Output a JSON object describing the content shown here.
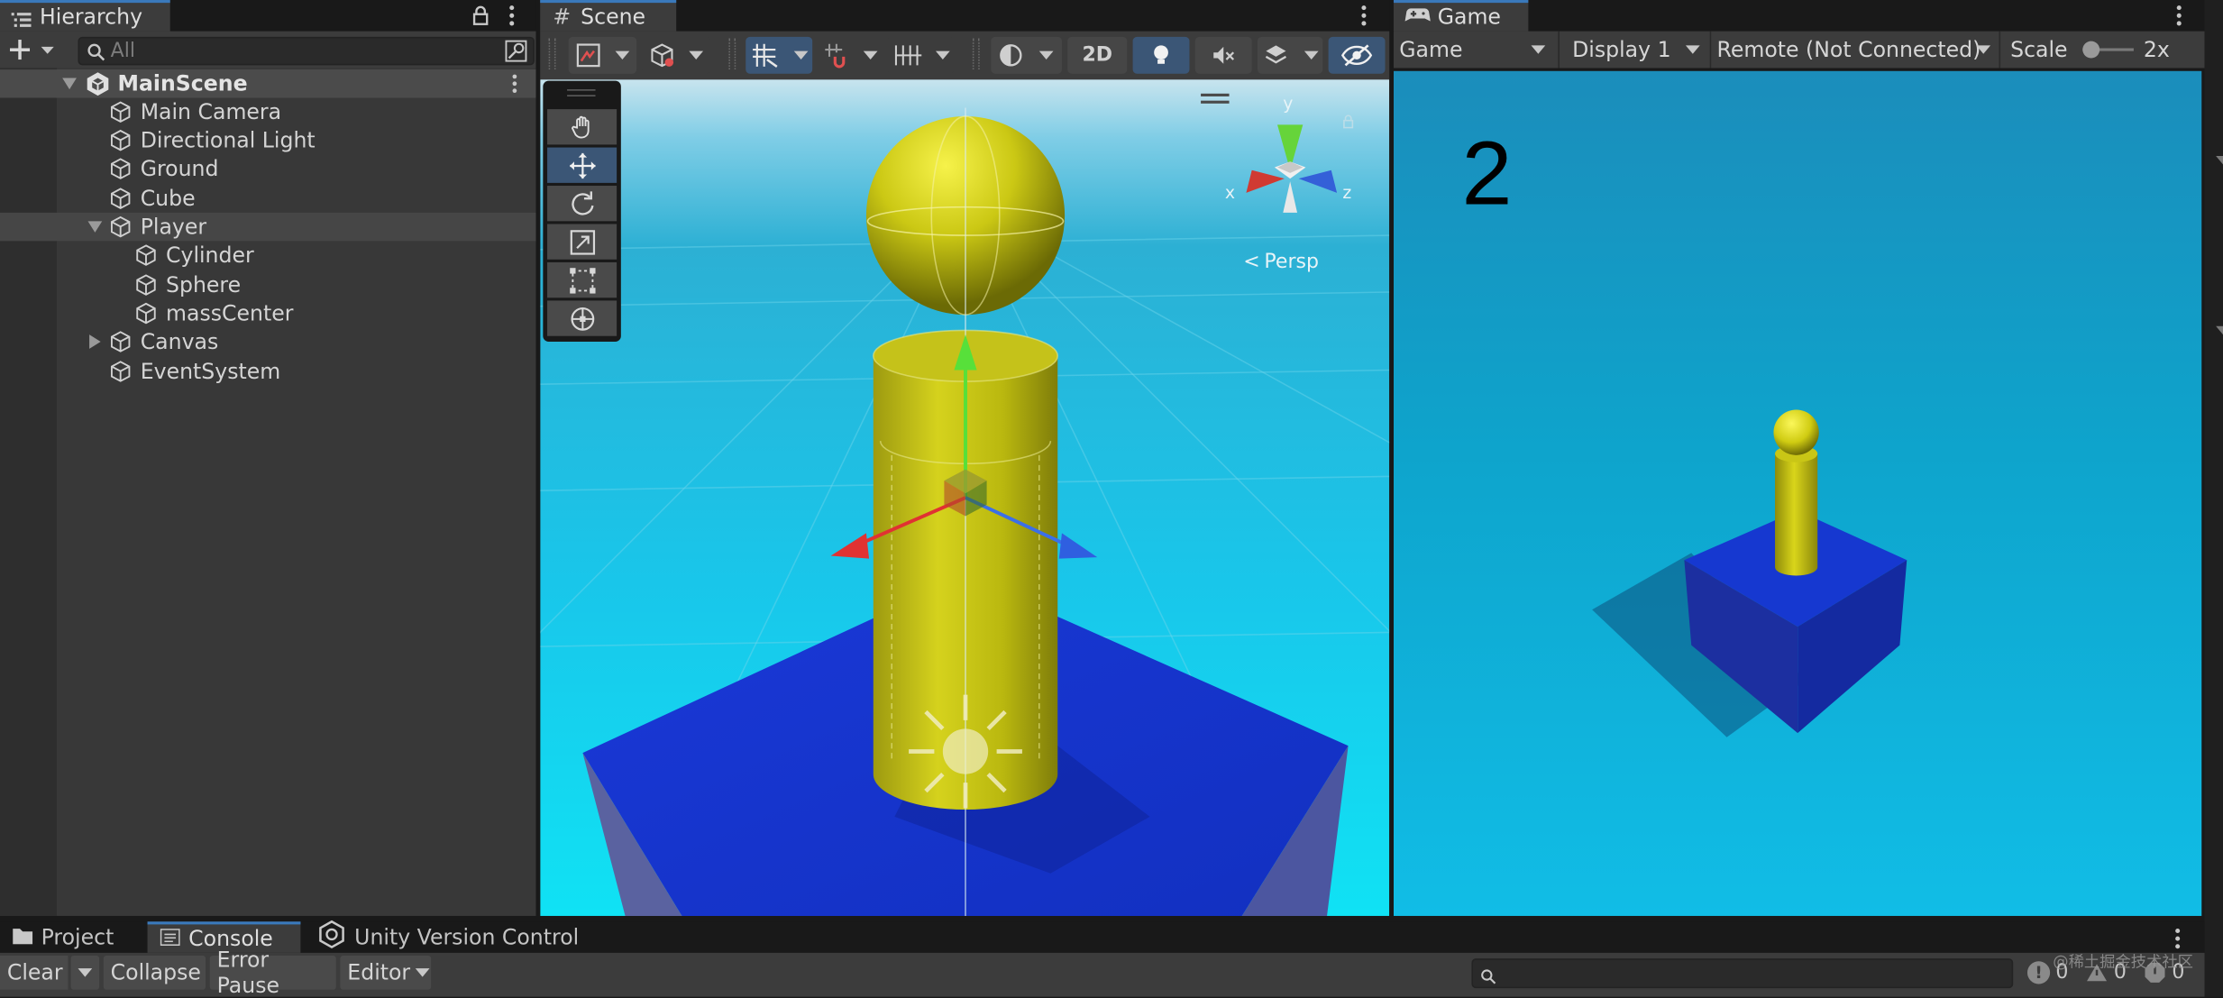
{
  "hierarchy": {
    "tab_label": "Hierarchy",
    "search_placeholder": "All",
    "scene_name": "MainScene",
    "items": [
      {
        "label": "Main Camera"
      },
      {
        "label": "Directional Light"
      },
      {
        "label": "Ground"
      },
      {
        "label": "Cube"
      },
      {
        "label": "Player"
      },
      {
        "label": "Cylinder"
      },
      {
        "label": "Sphere"
      },
      {
        "label": "massCenter"
      },
      {
        "label": "Canvas"
      },
      {
        "label": "EventSystem"
      }
    ]
  },
  "scene": {
    "tab_label": "Scene",
    "two_d_label": "2D",
    "persp_label": "Persp",
    "gizmo_axes": {
      "x": "x",
      "y": "y",
      "z": "z"
    }
  },
  "game": {
    "tab_label": "Game",
    "mode_label": "Game",
    "display_label": "Display 1",
    "remote_label": "Remote (Not Connected)",
    "scale_label": "Scale",
    "scale_value": "2x",
    "score_text": "2"
  },
  "bottom": {
    "tabs": [
      {
        "label": "Project"
      },
      {
        "label": "Console"
      },
      {
        "label": "Unity Version Control"
      }
    ],
    "clear_label": "Clear",
    "collapse_label": "Collapse",
    "error_pause_label": "Error Pause",
    "editor_label": "Editor",
    "counts": {
      "logs": "0",
      "warnings": "0",
      "errors": "0"
    },
    "watermark": "@稀土掘金技术社区"
  },
  "colors": {
    "accent": "#3a79bb",
    "selected_tool": "#3b5676",
    "yellow_object": "#c4c10e",
    "blue_cube": "#1331c8",
    "sky_cyan": "#12bfe6"
  }
}
